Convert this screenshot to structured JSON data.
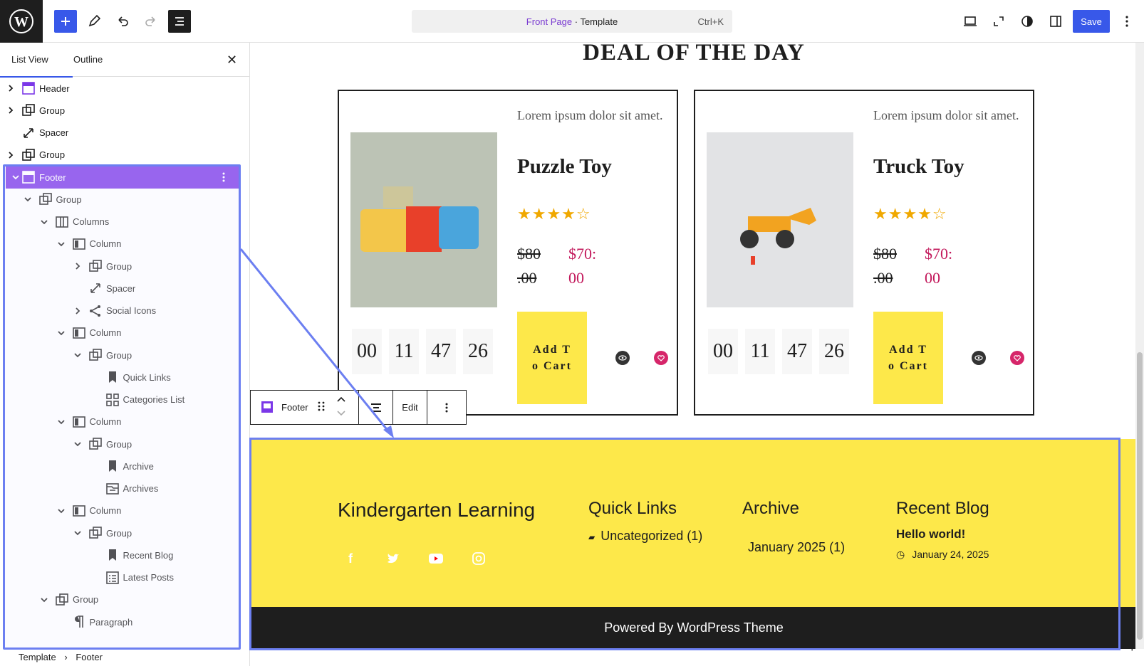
{
  "topbar": {
    "command_template_name": "Front Page",
    "command_separator": " · ",
    "command_type": "Template",
    "command_shortcut": "Ctrl+K",
    "save_label": "Save"
  },
  "sidebar": {
    "tabs": [
      "List View",
      "Outline"
    ],
    "close_icon": "close-icon",
    "rows": [
      {
        "label": "Header",
        "icon": "template-part-icon",
        "indent": 0,
        "chevron": "right"
      },
      {
        "label": "Group",
        "icon": "group-icon",
        "indent": 0,
        "chevron": "right"
      },
      {
        "label": "Spacer",
        "icon": "spacer-icon",
        "indent": 0,
        "chevron": ""
      },
      {
        "label": "Group",
        "icon": "group-icon",
        "indent": 0,
        "chevron": "right"
      },
      {
        "label": "Footer",
        "icon": "template-part-icon",
        "indent": 0,
        "chevron": "down",
        "selected": true
      },
      {
        "label": "Group",
        "icon": "group-icon",
        "indent": 1,
        "chevron": "down"
      },
      {
        "label": "Columns",
        "icon": "columns-icon",
        "indent": 2,
        "chevron": "down"
      },
      {
        "label": "Column",
        "icon": "column-icon",
        "indent": 3,
        "chevron": "down"
      },
      {
        "label": "Group",
        "icon": "group-icon",
        "indent": 4,
        "chevron": "right"
      },
      {
        "label": "Spacer",
        "icon": "spacer-icon",
        "indent": 4,
        "chevron": ""
      },
      {
        "label": "Social Icons",
        "icon": "share-icon",
        "indent": 4,
        "chevron": "right"
      },
      {
        "label": "Column",
        "icon": "column-icon",
        "indent": 3,
        "chevron": "down"
      },
      {
        "label": "Group",
        "icon": "group-icon",
        "indent": 4,
        "chevron": "down"
      },
      {
        "label": "Quick Links",
        "icon": "bookmark-icon",
        "indent": 5,
        "chevron": ""
      },
      {
        "label": "Categories List",
        "icon": "categories-icon",
        "indent": 5,
        "chevron": ""
      },
      {
        "label": "Column",
        "icon": "column-icon",
        "indent": 3,
        "chevron": "down"
      },
      {
        "label": "Group",
        "icon": "group-icon",
        "indent": 4,
        "chevron": "down"
      },
      {
        "label": "Archive",
        "icon": "bookmark-icon",
        "indent": 5,
        "chevron": ""
      },
      {
        "label": "Archives",
        "icon": "archive-icon",
        "indent": 5,
        "chevron": ""
      },
      {
        "label": "Column",
        "icon": "column-icon",
        "indent": 3,
        "chevron": "down"
      },
      {
        "label": "Group",
        "icon": "group-icon",
        "indent": 4,
        "chevron": "down"
      },
      {
        "label": "Recent Blog",
        "icon": "bookmark-icon",
        "indent": 5,
        "chevron": ""
      },
      {
        "label": "Latest Posts",
        "icon": "list-icon",
        "indent": 5,
        "chevron": ""
      },
      {
        "label": "Group",
        "icon": "group-icon",
        "indent": 2,
        "chevron": "down"
      },
      {
        "label": "Paragraph",
        "icon": "paragraph-icon",
        "indent": 3,
        "chevron": ""
      }
    ]
  },
  "breadcrumb": {
    "root": "Template",
    "sep": "›",
    "current": "Footer"
  },
  "canvas": {
    "deal_title": "DEAL OF THE DAY",
    "products": [
      {
        "lorem": "Lorem ipsum dolor sit amet.",
        "name": "Puzzle Toy",
        "stars": "★★★★☆",
        "old_price": "$80 .00",
        "new_price": "$70: 00",
        "cart": "Add To Cart",
        "countdown": [
          "00",
          "11",
          "47",
          "26"
        ]
      },
      {
        "lorem": "Lorem ipsum dolor sit amet.",
        "name": "Truck Toy",
        "stars": "★★★★☆",
        "old_price": "$80 .00",
        "new_price": "$70: 00",
        "cart": "Add To Cart",
        "countdown": [
          "00",
          "11",
          "47",
          "26"
        ]
      }
    ]
  },
  "block_toolbar": {
    "block_name": "Footer",
    "edit_label": "Edit"
  },
  "footer": {
    "site_title": "Kindergarten Learning",
    "quick_links_heading": "Quick Links",
    "quick_links_item": "Uncategorized (1)",
    "archive_heading": "Archive",
    "archive_item": "January 2025 (1)",
    "recent_heading": "Recent Blog",
    "recent_post_title": "Hello world!",
    "recent_post_date": "January 24, 2025",
    "copyright": "Powered By WordPress Theme",
    "social": [
      {
        "name": "facebook-icon",
        "color": "#1877f2"
      },
      {
        "name": "twitter-icon",
        "color": "#1da1f2"
      },
      {
        "name": "youtube-icon",
        "color": "#ff0000"
      },
      {
        "name": "instagram-icon",
        "color": "#e1306c"
      }
    ]
  },
  "colors": {
    "accent": "#3858e9",
    "selection": "#7b37e8",
    "footer_bg": "#fde84a",
    "highlight": "#6c7ff1"
  }
}
